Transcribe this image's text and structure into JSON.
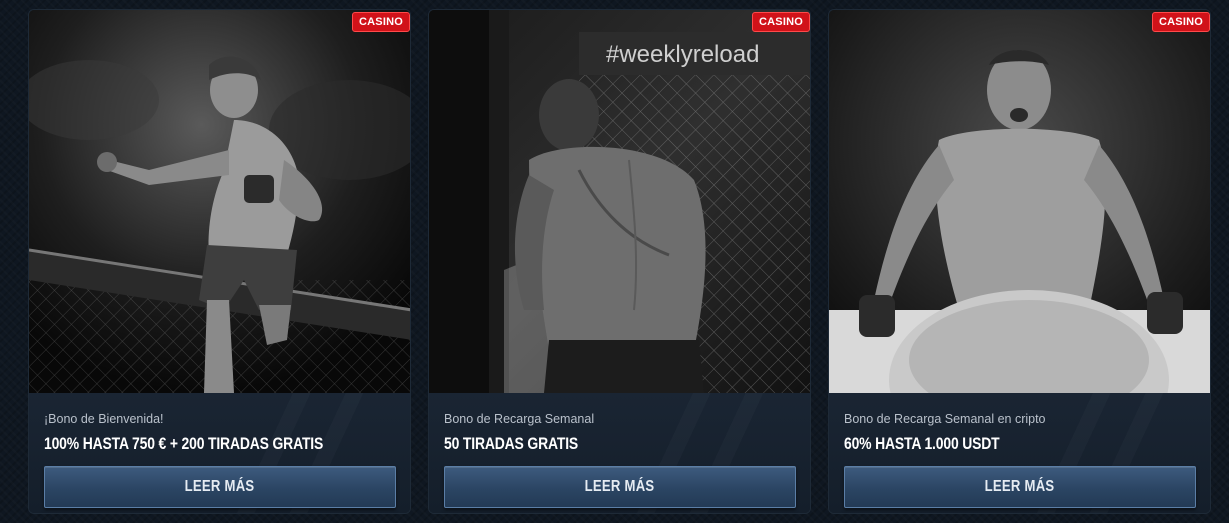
{
  "badge_label": "CASINO",
  "cards": [
    {
      "subtitle": "¡Bono de Bienvenida!",
      "offer": "100% HASTA 750 € + 200 TIRADAS GRATIS",
      "button_label": "LEER MÁS"
    },
    {
      "subtitle": "Bono de Recarga Semanal",
      "offer": "50 TIRADAS GRATIS",
      "button_label": "LEER MÁS",
      "banner_text": "#weeklyreload"
    },
    {
      "subtitle": "Bono de Recarga Semanal en cripto",
      "offer": "60% HASTA 1.000 USDT",
      "button_label": "LEER MÁS"
    }
  ],
  "colors": {
    "badge": "#d11219",
    "button": "#2b4563",
    "card_bg": "#172230",
    "page_bg": "#0f1721"
  }
}
